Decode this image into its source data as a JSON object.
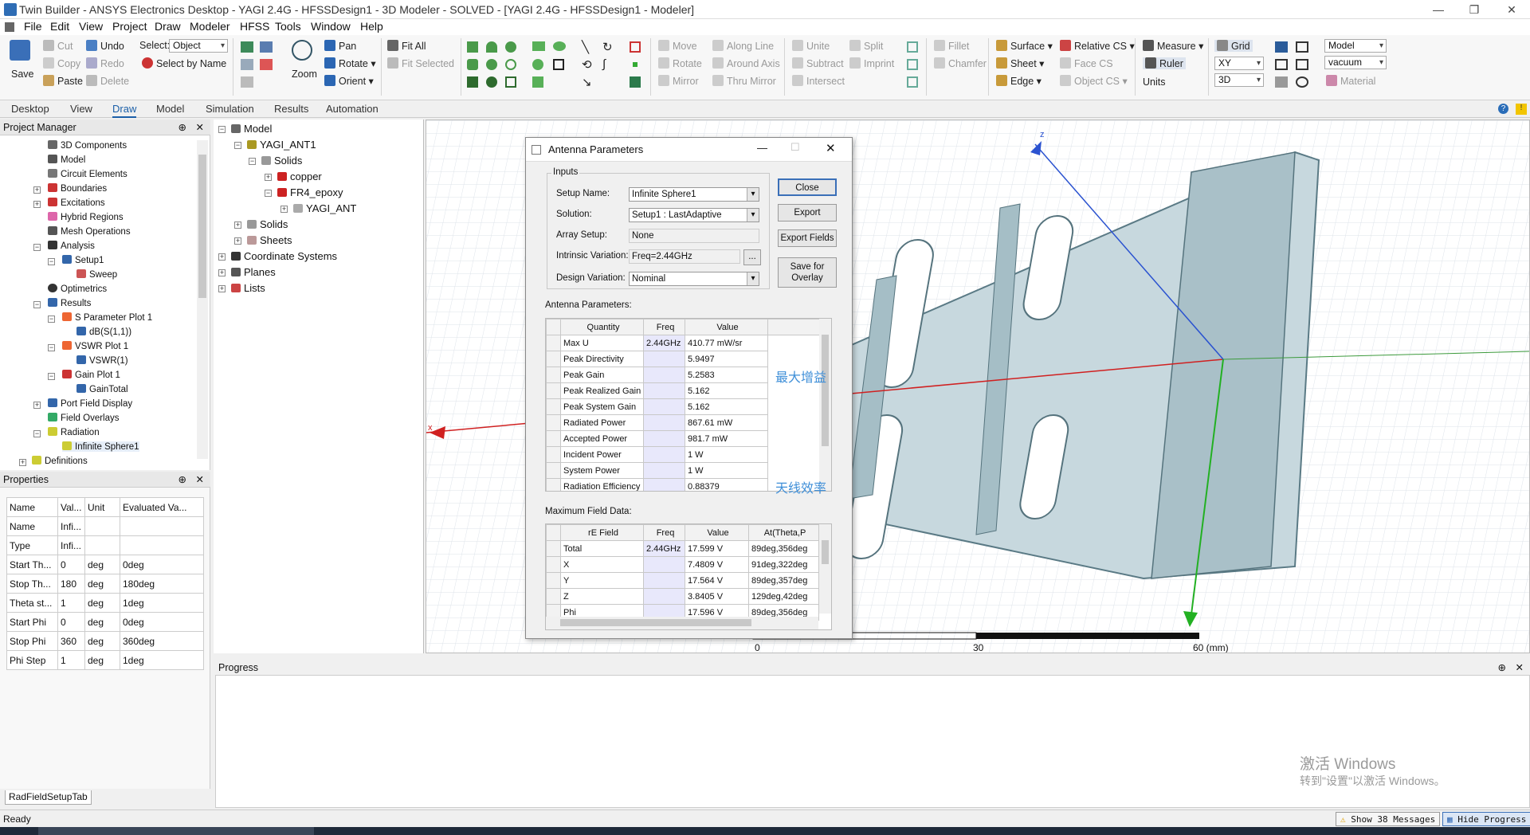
{
  "window": {
    "title": "Twin Builder - ANSYS Electronics Desktop - YAGI 2.4G - HFSSDesign1 - 3D Modeler - SOLVED - [YAGI 2.4G - HFSSDesign1 - Modeler]"
  },
  "menu": [
    "File",
    "Edit",
    "View",
    "Project",
    "Draw",
    "Modeler",
    "HFSS",
    "Tools",
    "Window",
    "Help"
  ],
  "ribbon": {
    "save": "Save",
    "cut": "Cut",
    "copy": "Copy",
    "paste": "Paste",
    "undo": "Undo",
    "redo": "Redo",
    "delete": "Delete",
    "select_label": "Select:",
    "select_value": "Object",
    "select_by_name": "Select by Name",
    "zoom": "Zoom",
    "pan": "Pan",
    "rotate": "Rotate",
    "orient": "Orient",
    "fit_all": "Fit All",
    "fit_selected": "Fit Selected",
    "move": "Move",
    "rotate2": "Rotate",
    "mirror": "Mirror",
    "along_line": "Along Line",
    "around_axis": "Around Axis",
    "thru_mirror": "Thru Mirror",
    "unite": "Unite",
    "subtract": "Subtract",
    "intersect": "Intersect",
    "split": "Split",
    "imprint": "Imprint",
    "fillet": "Fillet",
    "chamfer": "Chamfer",
    "surface": "Surface",
    "sheet": "Sheet",
    "edge": "Edge",
    "relative_cs": "Relative CS",
    "face_cs": "Face CS",
    "object_cs": "Object CS",
    "measure": "Measure",
    "ruler": "Ruler",
    "units": "Units",
    "grid": "Grid",
    "plane": "XY",
    "dim": "3D",
    "model": "Model",
    "material_value": "vacuum",
    "material": "Material"
  },
  "tabs": [
    "Desktop",
    "View",
    "Draw",
    "Model",
    "Simulation",
    "Results",
    "Automation"
  ],
  "project_manager": {
    "title": "Project Manager",
    "items": [
      "3D Components",
      "Model",
      "Circuit Elements",
      "Boundaries",
      "Excitations",
      "Hybrid Regions",
      "Mesh Operations",
      "Analysis",
      "Setup1",
      "Sweep",
      "Optimetrics",
      "Results",
      "S Parameter Plot 1",
      "dB(S(1,1))",
      "VSWR Plot 1",
      "VSWR(1)",
      "Gain Plot 1",
      "GainTotal",
      "Port Field Display",
      "Field Overlays",
      "Radiation",
      "Infinite Sphere1",
      "Definitions"
    ]
  },
  "model_tree": {
    "items": [
      "Model",
      "YAGI_ANT1",
      "Solids",
      "copper",
      "FR4_epoxy",
      "YAGI_ANT",
      "Solids",
      "Sheets",
      "Coordinate Systems",
      "Planes",
      "Lists"
    ]
  },
  "properties": {
    "title": "Properties",
    "headers": [
      "Name",
      "Val...",
      "Unit",
      "Evaluated Va..."
    ],
    "rows": [
      [
        "Name",
        "Infi...",
        "",
        ""
      ],
      [
        "Type",
        "Infi...",
        "",
        ""
      ],
      [
        "Start Th...",
        "0",
        "deg",
        "0deg"
      ],
      [
        "Stop Th...",
        "180",
        "deg",
        "180deg"
      ],
      [
        "Theta st...",
        "1",
        "deg",
        "1deg"
      ],
      [
        "Start Phi",
        "0",
        "deg",
        "0deg"
      ],
      [
        "Stop Phi",
        "360",
        "deg",
        "360deg"
      ],
      [
        "Phi Step",
        "1",
        "deg",
        "1deg"
      ]
    ],
    "tab": "RadFieldSetupTab"
  },
  "dialog": {
    "title": "Antenna Parameters",
    "inputs_label": "Inputs",
    "setup_name_label": "Setup Name:",
    "setup_name": "Infinite Sphere1",
    "solution_label": "Solution:",
    "solution": "Setup1 : LastAdaptive",
    "array_label": "Array Setup:",
    "array": "None",
    "intrinsic_label": "Intrinsic Variation:",
    "intrinsic": "Freq=2.44GHz",
    "ellipsis": "...",
    "design_label": "Design Variation:",
    "design": "Nominal",
    "close": "Close",
    "export": "Export",
    "export_fields": "Export Fields",
    "save_overlay_1": "Save for",
    "save_overlay_2": "Overlay",
    "params_label": "Antenna Parameters:",
    "params_headers": [
      "Quantity",
      "Freq",
      "Value"
    ],
    "params": [
      [
        "Max U",
        "2.44GHz",
        "410.77 mW/sr"
      ],
      [
        "Peak Directivity",
        "",
        "5.9497"
      ],
      [
        "Peak Gain",
        "",
        "5.2583"
      ],
      [
        "Peak Realized Gain",
        "",
        "5.162"
      ],
      [
        "Peak System Gain",
        "",
        "5.162"
      ],
      [
        "Radiated Power",
        "",
        "867.61 mW"
      ],
      [
        "Accepted Power",
        "",
        "981.7 mW"
      ],
      [
        "Incident Power",
        "",
        "1 W"
      ],
      [
        "System Power",
        "",
        "1 W"
      ],
      [
        "Radiation Efficiency",
        "",
        "0.88379"
      ]
    ],
    "note_gain": "最大增益",
    "note_eff": "天线效率",
    "field_label": "Maximum Field Data:",
    "field_headers": [
      "rE Field",
      "Freq",
      "Value",
      "At(Theta,P"
    ],
    "fields": [
      [
        "Total",
        "2.44GHz",
        "17.599 V",
        "89deg,356deg"
      ],
      [
        "X",
        "",
        "7.4809 V",
        "91deg,322deg"
      ],
      [
        "Y",
        "",
        "17.564 V",
        "89deg,357deg"
      ],
      [
        "Z",
        "",
        "3.8405 V",
        "129deg,42deg"
      ],
      [
        "Phi",
        "",
        "17.596 V",
        "89deg,356deg"
      ]
    ]
  },
  "viewport": {
    "scale_0": "0",
    "scale_30": "30",
    "scale_60": "60 (mm)",
    "axis_z": "z",
    "axis_x": "x"
  },
  "progress": {
    "title": "Progress",
    "watermark_1": "激活 Windows",
    "watermark_2": "转到\"设置\"以激活 Windows。"
  },
  "status": {
    "ready": "Ready",
    "messages": "Show 38 Messages",
    "hide_progress": "Hide Progress"
  }
}
